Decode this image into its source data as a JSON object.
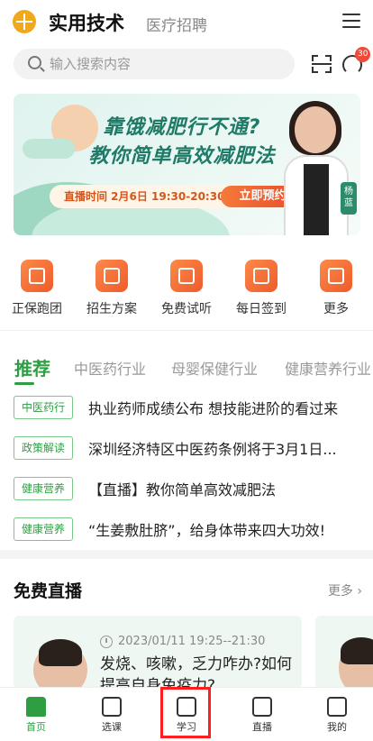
{
  "header": {
    "title": "实用技术",
    "secondary_tab": "医疗招聘"
  },
  "search": {
    "placeholder": "输入搜索内容"
  },
  "message_badge": "30",
  "banner": {
    "title_line1": "靠饿减肥行不通?",
    "title_line2": "教你简单高效减肥法",
    "live_time": "直播时间 2月6日 19:30-20:30",
    "reserve_label": "立即预约",
    "host_name": "杨蓝"
  },
  "quick_entries": [
    {
      "label": "正保跑团",
      "icon": "runner-icon"
    },
    {
      "label": "招生方案",
      "icon": "book-icon"
    },
    {
      "label": "免费试听",
      "icon": "headphones-icon"
    },
    {
      "label": "每日签到",
      "icon": "checkin-icon"
    },
    {
      "label": "更多",
      "icon": "grid-icon"
    }
  ],
  "category_tabs": [
    "推荐",
    "中医药行业",
    "母婴保健行业",
    "健康营养行业"
  ],
  "news": [
    {
      "tag": "中医药行",
      "title": "执业药师成绩公布 想技能进阶的看过来"
    },
    {
      "tag": "政策解读",
      "title": "深圳经济特区中医药条例将于3月1日..."
    },
    {
      "tag": "健康营养",
      "title": "【直播】教你简单高效减肥法"
    },
    {
      "tag": "健康营养",
      "title": "“生姜敷肚脐”，给身体带来四大功效!"
    }
  ],
  "free_live": {
    "title": "免费直播",
    "more_label": "更多",
    "card": {
      "time": "2023/01/11 19:25--21:30",
      "title": "发烧、咳嗽，乏力咋办?如何提高自身免疫力?"
    }
  },
  "bottom_nav": [
    {
      "label": "首页",
      "icon": "home-icon",
      "active": true
    },
    {
      "label": "选课",
      "icon": "course-icon",
      "active": false
    },
    {
      "label": "学习",
      "icon": "study-icon",
      "active": false
    },
    {
      "label": "直播",
      "icon": "tv-icon",
      "active": false
    },
    {
      "label": "我的",
      "icon": "profile-icon",
      "active": false
    }
  ],
  "colors": {
    "brand_green": "#2f9e43",
    "accent_orange": "#ef5a2a",
    "highlight_red": "#ff1d1d"
  }
}
